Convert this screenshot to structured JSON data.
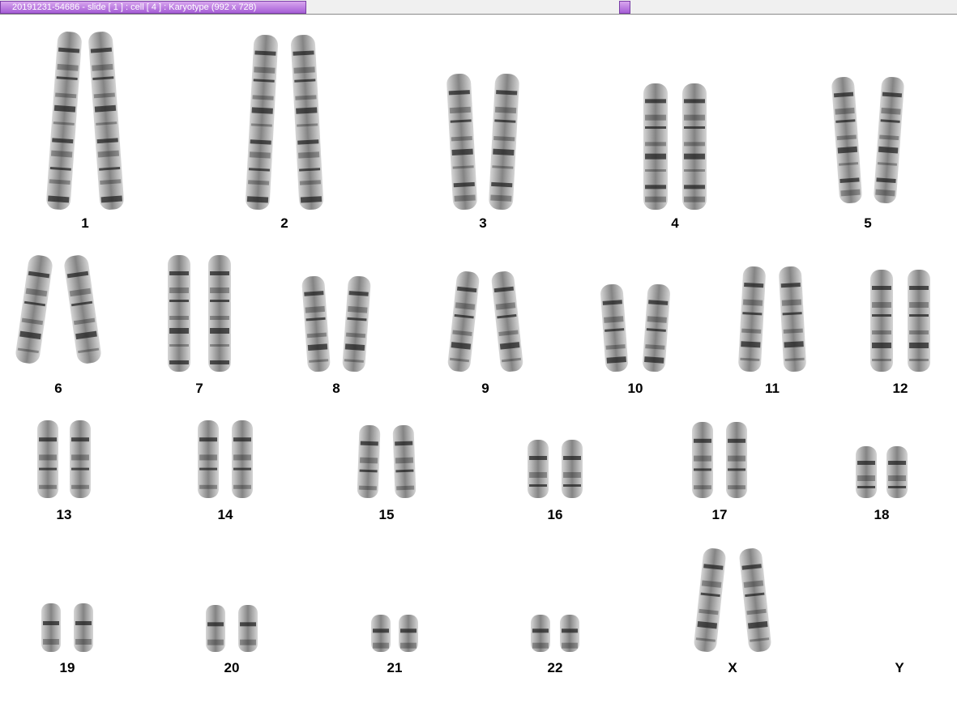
{
  "window": {
    "title": "20191231-54686 - slide [ 1 ] : cell [ 4 ] : Karyotype  (992 x 728)"
  },
  "karyotype": {
    "labels": [
      "1",
      "2",
      "3",
      "4",
      "5",
      "6",
      "7",
      "8",
      "9",
      "10",
      "11",
      "12",
      "13",
      "14",
      "15",
      "16",
      "17",
      "18",
      "19",
      "20",
      "21",
      "22",
      "X",
      "Y"
    ],
    "colors": {
      "band_dark": "#1a1a1a",
      "band_light": "#9a9a9a",
      "background": "#ffffff",
      "title_accent": "#a65ed6"
    }
  }
}
